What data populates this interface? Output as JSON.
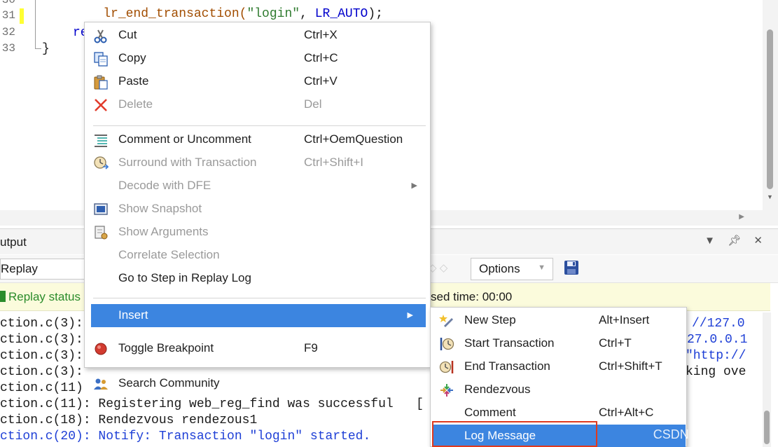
{
  "editor": {
    "line_numbers": [
      "30",
      "31",
      "32",
      "33"
    ],
    "line30": {
      "fn": "lr_end_transaction(",
      "arg1": "\"login\"",
      "mid": ", ",
      "arg2": "LR_AUTO",
      "end": ");"
    },
    "line32": "re",
    "line33": "}"
  },
  "output_panel": {
    "title": "utput",
    "replay_select": "Replay",
    "options_label": "Options",
    "status_left": "Replay status",
    "status_right": "sed time: 00:00",
    "log_lines": [
      {
        "file": "ction.c(3):",
        "text": ""
      },
      {
        "file": "ction.c(3):",
        "text": ""
      },
      {
        "file": "ction.c(3):",
        "text": ""
      },
      {
        "file": "ction.c(3):",
        "text": ""
      },
      {
        "file": "ction.c(11)",
        "text": ""
      },
      {
        "file": "ction.c(11):",
        "text": " Registering web_reg_find was successful   ["
      },
      {
        "file": "ction.c(18):",
        "text": " Rendezvous rendezous1"
      },
      {
        "file": "ction.c(20):",
        "text": " Notify: Transaction \"login\" started."
      }
    ],
    "log_right": [
      "//127.0",
      "27.0.0.1",
      "\"http://",
      "king ove"
    ]
  },
  "context_menu": {
    "items": [
      {
        "label": "Cut",
        "shortcut": "Ctrl+X",
        "icon": "scissors-icon",
        "enabled": true
      },
      {
        "label": "Copy",
        "shortcut": "Ctrl+C",
        "icon": "copy-icon",
        "enabled": true
      },
      {
        "label": "Paste",
        "shortcut": "Ctrl+V",
        "icon": "paste-icon",
        "enabled": true
      },
      {
        "label": "Delete",
        "shortcut": "Del",
        "icon": "delete-x-icon",
        "enabled": false
      },
      {
        "label": "Comment or Uncomment",
        "shortcut": "Ctrl+OemQuestion",
        "icon": "comment-lines-icon",
        "enabled": true
      },
      {
        "label": "Surround with Transaction",
        "shortcut": "Ctrl+Shift+I",
        "icon": "transaction-clock-icon",
        "enabled": false
      },
      {
        "label": "Decode with DFE",
        "shortcut": "",
        "icon": "",
        "enabled": false
      },
      {
        "label": "Show Snapshot",
        "shortcut": "",
        "icon": "snapshot-icon",
        "enabled": false
      },
      {
        "label": "Show Arguments",
        "shortcut": "",
        "icon": "arguments-icon",
        "enabled": false
      },
      {
        "label": "Correlate Selection",
        "shortcut": "",
        "icon": "",
        "enabled": false
      },
      {
        "label": "Go to Step in Replay Log",
        "shortcut": "",
        "icon": "",
        "enabled": true
      },
      {
        "label": "Insert",
        "shortcut": "",
        "icon": "",
        "enabled": true
      },
      {
        "label": "Toggle Breakpoint",
        "shortcut": "F9",
        "icon": "breakpoint-icon",
        "enabled": true
      },
      {
        "label": "Search Community",
        "shortcut": "",
        "icon": "community-icon",
        "enabled": true
      }
    ]
  },
  "insert_submenu": {
    "items": [
      {
        "label": "New Step",
        "shortcut": "Alt+Insert",
        "icon": "new-step-icon"
      },
      {
        "label": "Start Transaction",
        "shortcut": "Ctrl+T",
        "icon": "start-transaction-icon"
      },
      {
        "label": "End Transaction",
        "shortcut": "Ctrl+Shift+T",
        "icon": "end-transaction-icon"
      },
      {
        "label": "Rendezvous",
        "shortcut": "",
        "icon": "rendezvous-icon"
      },
      {
        "label": "Comment",
        "shortcut": "Ctrl+Alt+C",
        "icon": ""
      },
      {
        "label": "Log Message",
        "shortcut": "",
        "icon": ""
      }
    ]
  },
  "watermark": "CSDN @明天不吃。",
  "colors": {
    "menu_highlight": "#3c85e0",
    "annotation_box": "#e03a1e",
    "status_bg": "#fbfbdc"
  }
}
